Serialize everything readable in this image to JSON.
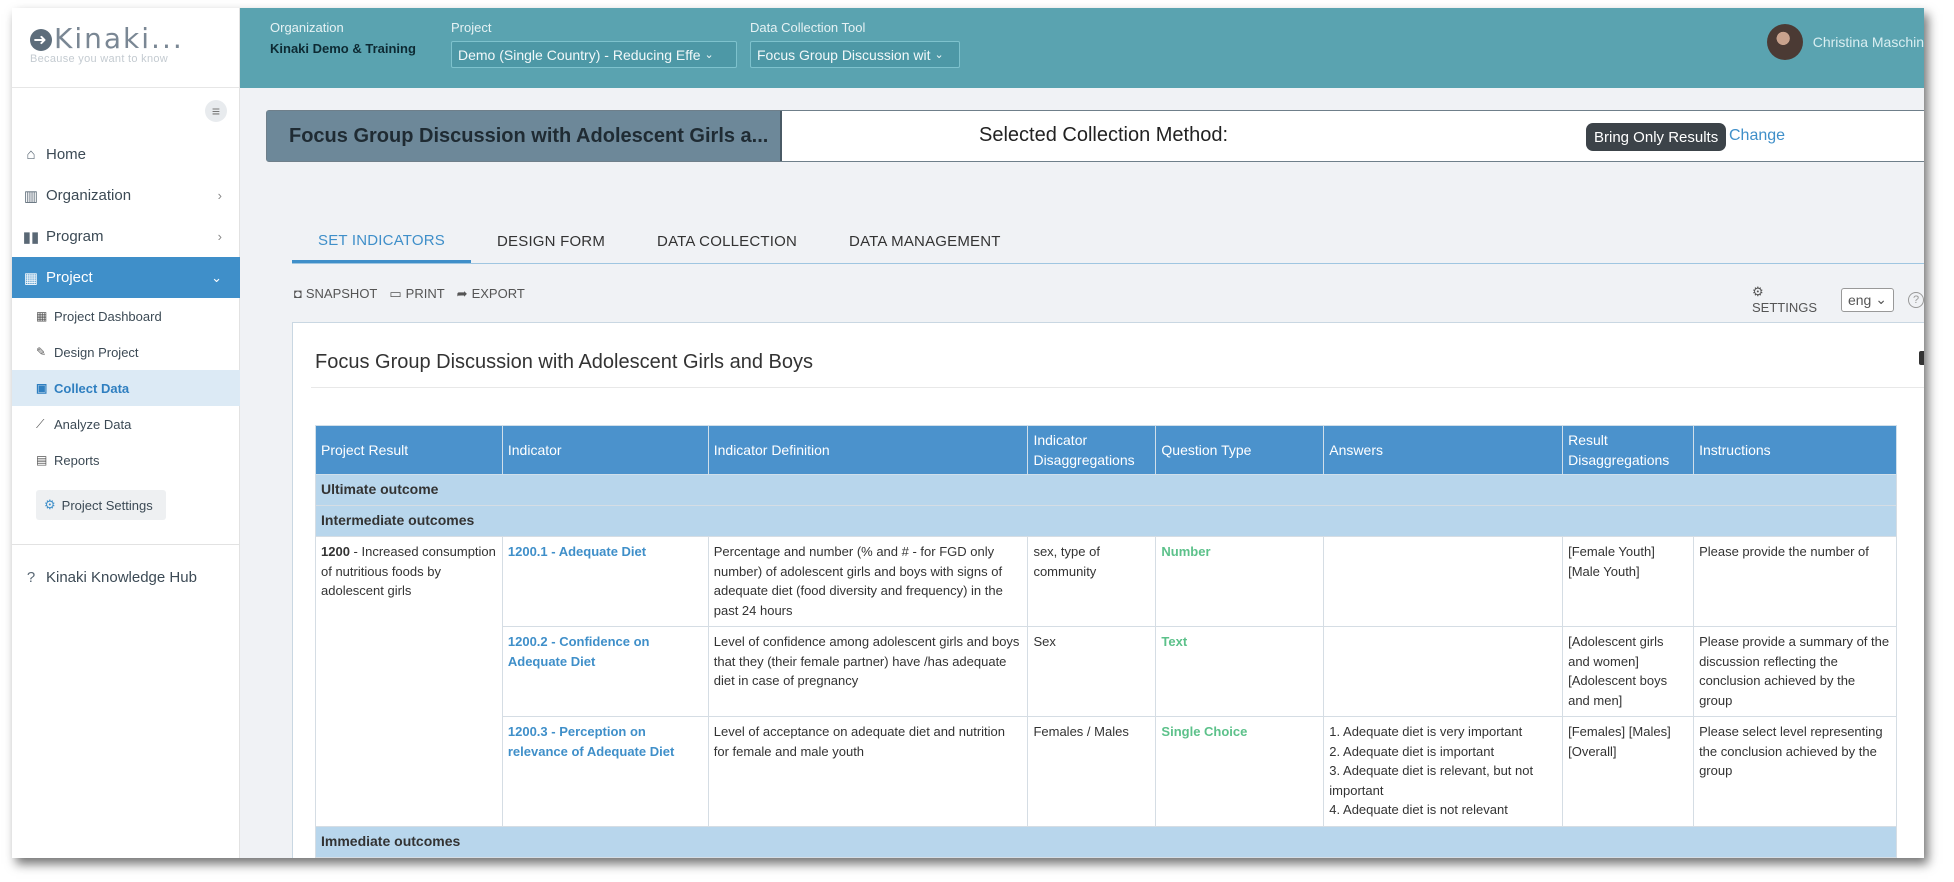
{
  "brand": {
    "name": "Kinaki...",
    "tagline": "Because you want to know"
  },
  "topbar": {
    "organization_label": "Organization",
    "organization_value": "Kinaki Demo & Training",
    "project_label": "Project",
    "project_value": "Demo (Single Country) - Reducing Effe",
    "tool_label": "Data Collection Tool",
    "tool_value": "Focus Group Discussion wit",
    "user_name": "Christina Maschin"
  },
  "sidebar": {
    "items": [
      {
        "label": "Home",
        "icon": "home-icon"
      },
      {
        "label": "Organization",
        "icon": "organization-icon"
      },
      {
        "label": "Program",
        "icon": "program-icon"
      },
      {
        "label": "Project",
        "icon": "project-icon"
      }
    ],
    "sub_items": [
      {
        "label": "Project Dashboard"
      },
      {
        "label": "Design Project"
      },
      {
        "label": "Collect Data"
      },
      {
        "label": "Analyze Data"
      },
      {
        "label": "Reports"
      }
    ],
    "project_settings": "Project Settings",
    "knowledge_hub": "Kinaki Knowledge Hub"
  },
  "collection_bar": {
    "tool_name": "Focus Group Discussion with Adolescent Girls a...",
    "method_label": "Selected Collection Method:",
    "method_value": "Bring Only Results",
    "change_label": "Change"
  },
  "tabs": [
    "SET INDICATORS",
    "DESIGN FORM",
    "DATA COLLECTION",
    "DATA MANAGEMENT"
  ],
  "toolbar": {
    "snapshot": "SNAPSHOT",
    "print": "PRINT",
    "export": "EXPORT",
    "settings": "SETTINGS",
    "language": "eng"
  },
  "card": {
    "title": "Focus Group Discussion with Adolescent Girls and Boys"
  },
  "table": {
    "headers": [
      "Project Result",
      "Indicator",
      "Indicator Definition",
      "Indicator Disaggregations",
      "Question Type",
      "Answers",
      "Result Disaggregations",
      "Instructions"
    ],
    "sections": {
      "ultimate": "Ultimate outcome",
      "intermediate": "Intermediate outcomes",
      "immediate": "Immediate outcomes"
    },
    "result": {
      "code": "1200",
      "text": " - Increased consumption of nutritious foods by adolescent girls"
    },
    "rows": [
      {
        "indicator": "1200.1 - Adequate Diet",
        "definition": "Percentage and number (% and # - for FGD only number) of adolescent girls and boys with signs of adequate diet (food diversity and frequency) in the past 24 hours",
        "disaggregations": "sex, type of community",
        "question_type": "Number",
        "answers": "",
        "result_disaggregations": "[Female Youth] [Male Youth]",
        "instructions": "Please provide the number of"
      },
      {
        "indicator": "1200.2 - Confidence on Adequate Diet",
        "definition": "Level of confidence among adolescent girls and boys that they (their female partner) have /has adequate diet in case of pregnancy",
        "disaggregations": "Sex",
        "question_type": "Text",
        "answers": "",
        "result_disaggregations": "[Adolescent girls and women] [Adolescent boys and men]",
        "instructions": "Please provide a summary of the discussion reflecting the conclusion achieved by the group"
      },
      {
        "indicator": "1200.3 - Perception on relevance of Adequate Diet",
        "definition": "Level of acceptance on adequate diet and nutrition for female and male youth",
        "disaggregations": "Females / Males",
        "question_type": "Single Choice",
        "answers": [
          "1.  Adequate diet is very important",
          "2.  Adequate diet is important",
          "3.  Adequate diet is relevant, but not important",
          "4.  Adequate diet is not relevant"
        ],
        "result_disaggregations": "[Females] [Males] [Overall]",
        "instructions": "Please select level representing the conclusion achieved by the group"
      }
    ]
  },
  "colors": {
    "topbar": "#5aa3b0",
    "accent": "#3f8fc9",
    "question_type": "#5cc18a",
    "section": "#b8d6ec"
  }
}
